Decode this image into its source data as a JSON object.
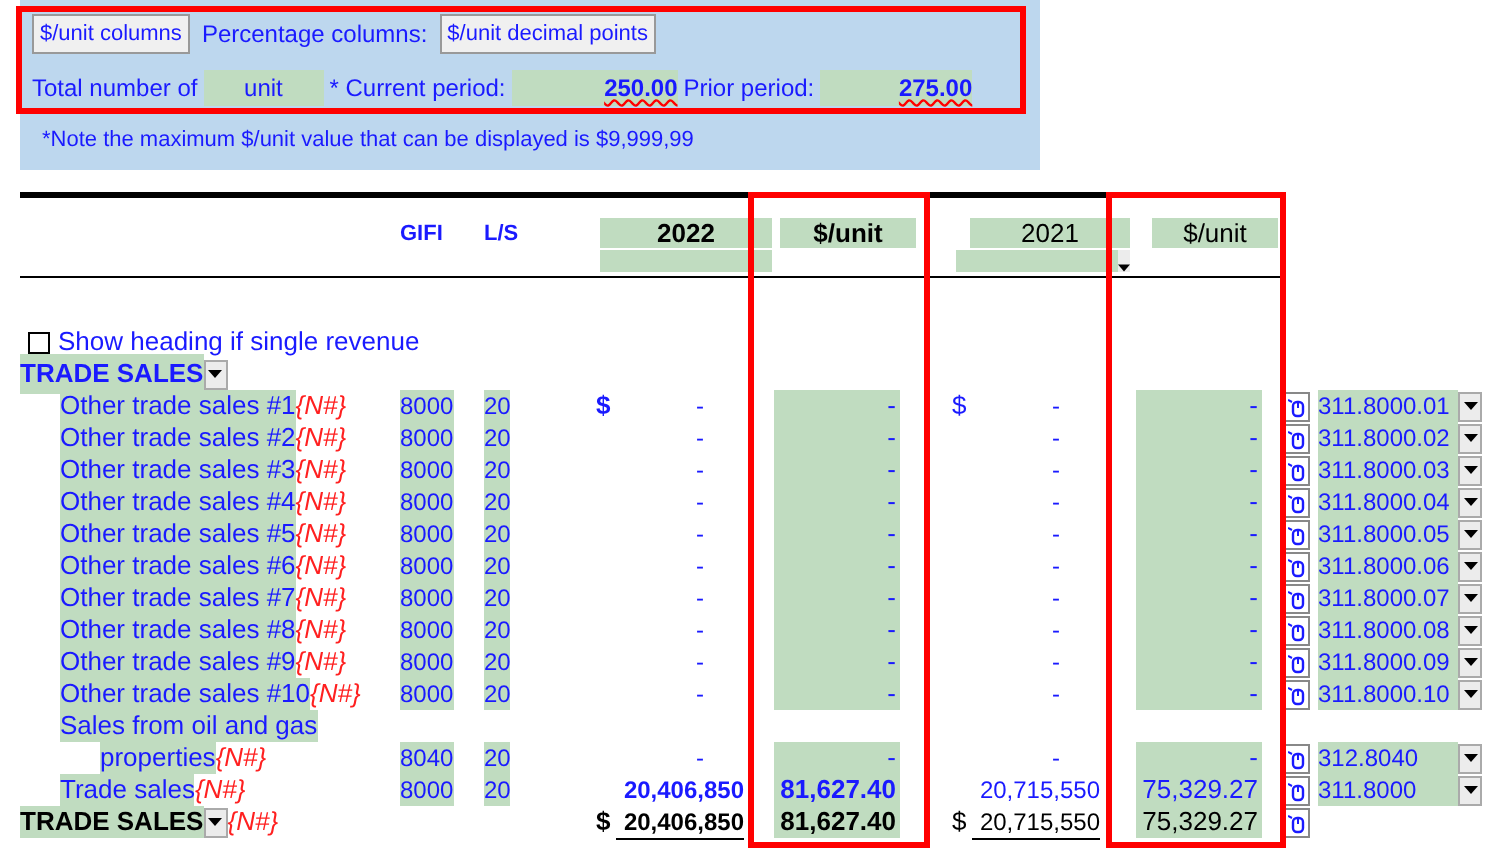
{
  "toolbar": {
    "buttons": [
      "$/unit columns",
      "$/unit decimal points"
    ],
    "percentage_label": "Percentage columns:",
    "total_label": "Total number of",
    "unit_field": "unit",
    "current_label": "* Current period:",
    "current_value": "250.00",
    "prior_label": "Prior period:",
    "prior_value": "275.00",
    "note": "*Note the maximum $/unit value that can be displayed is $9,999,99"
  },
  "header": {
    "gifi": "GIFI",
    "ls": "L/S",
    "current_year": "2022",
    "current_unit": "$/unit",
    "prior_year": "2021",
    "prior_unit": "$/unit"
  },
  "checkbox": {
    "label": "Show heading if single revenue",
    "checked": false
  },
  "section_heading": "TRADE SALES",
  "rows": [
    {
      "kind": "line",
      "label": "Other trade sales #1",
      "tag": "{N#}",
      "gifi": "8000",
      "ls": "20",
      "cur_sign": "$",
      "cur": "-",
      "cur_unit": "-",
      "prior_sign": "$",
      "prior": "-",
      "prior_unit": "-",
      "code": "311.8000.01"
    },
    {
      "kind": "line",
      "label": "Other trade sales #2",
      "tag": "{N#}",
      "gifi": "8000",
      "ls": "20",
      "cur": "-",
      "cur_unit": "-",
      "prior": "-",
      "prior_unit": "-",
      "code": "311.8000.02"
    },
    {
      "kind": "line",
      "label": "Other trade sales #3",
      "tag": "{N#}",
      "gifi": "8000",
      "ls": "20",
      "cur": "-",
      "cur_unit": "-",
      "prior": "-",
      "prior_unit": "-",
      "code": "311.8000.03"
    },
    {
      "kind": "line",
      "label": "Other trade sales #4",
      "tag": "{N#}",
      "gifi": "8000",
      "ls": "20",
      "cur": "-",
      "cur_unit": "-",
      "prior": "-",
      "prior_unit": "-",
      "code": "311.8000.04"
    },
    {
      "kind": "line",
      "label": "Other trade sales #5",
      "tag": "{N#}",
      "gifi": "8000",
      "ls": "20",
      "cur": "-",
      "cur_unit": "-",
      "prior": "-",
      "prior_unit": "-",
      "code": "311.8000.05"
    },
    {
      "kind": "line",
      "label": "Other trade sales #6",
      "tag": "{N#}",
      "gifi": "8000",
      "ls": "20",
      "cur": "-",
      "cur_unit": "-",
      "prior": "-",
      "prior_unit": "-",
      "code": "311.8000.06"
    },
    {
      "kind": "line",
      "label": "Other trade sales #7",
      "tag": "{N#}",
      "gifi": "8000",
      "ls": "20",
      "cur": "-",
      "cur_unit": "-",
      "prior": "-",
      "prior_unit": "-",
      "code": "311.8000.07"
    },
    {
      "kind": "line",
      "label": "Other trade sales #8",
      "tag": "{N#}",
      "gifi": "8000",
      "ls": "20",
      "cur": "-",
      "cur_unit": "-",
      "prior": "-",
      "prior_unit": "-",
      "code": "311.8000.08"
    },
    {
      "kind": "line",
      "label": "Other trade sales #9",
      "tag": "{N#}",
      "gifi": "8000",
      "ls": "20",
      "cur": "-",
      "cur_unit": "-",
      "prior": "-",
      "prior_unit": "-",
      "code": "311.8000.09"
    },
    {
      "kind": "line",
      "label": "Other trade sales #10",
      "tag": "{N#}",
      "gifi": "8000",
      "ls": "20",
      "cur": "-",
      "cur_unit": "-",
      "prior": "-",
      "prior_unit": "-",
      "code": "311.8000.10"
    },
    {
      "kind": "line",
      "label": "Sales from oil and gas",
      "label_continued": "properties",
      "tag": "{N#}",
      "gifi": "8040",
      "ls": "20",
      "cur": "-",
      "cur_unit": "-",
      "prior": "-",
      "prior_unit": "-",
      "code": "312.8040"
    },
    {
      "kind": "subtotal",
      "label": "Trade sales",
      "tag": "{N#}",
      "gifi": "8000",
      "ls": "20",
      "cur": "20,406,850",
      "cur_unit": "81,627.40",
      "prior": "20,715,550",
      "prior_unit": "75,329.27",
      "code": "311.8000"
    },
    {
      "kind": "total",
      "label": "TRADE SALES",
      "tag": "{N#}",
      "cur_sign": "$",
      "cur": "20,406,850",
      "cur_unit": "81,627.40",
      "prior_sign": "$",
      "prior": "20,715,550",
      "prior_unit": "75,329.27"
    }
  ]
}
